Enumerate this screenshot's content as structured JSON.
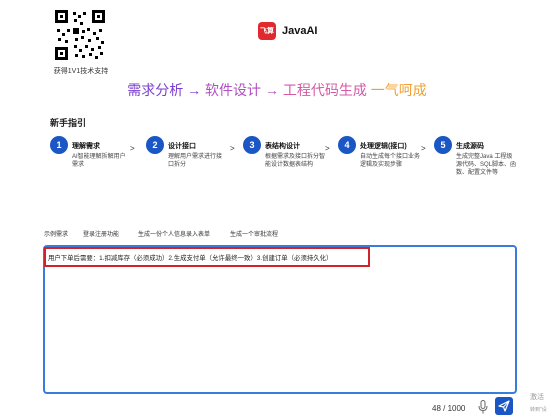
{
  "qr": {
    "caption": "获得1V1技术支持"
  },
  "brand": {
    "logo_text": "飞算",
    "name": "JavaAI"
  },
  "slogan": {
    "part1": "需求分析 → ",
    "part2": "软件设计 → ",
    "part3": "工程代码生成 ",
    "part4": "一气呵成"
  },
  "guide": {
    "title": "新手指引",
    "arrow": ">",
    "steps": [
      {
        "num": "1",
        "title": "理解需求",
        "desc": "AI智能理解拆解用户需求"
      },
      {
        "num": "2",
        "title": "设计接口",
        "desc": "理解用户需求进行接口拆分"
      },
      {
        "num": "3",
        "title": "表结构设计",
        "desc": "根据需求及接口拆分智能设计数据表结构"
      },
      {
        "num": "4",
        "title": "处理逻辑(接口)",
        "desc": "自动生成每个接口业务逻辑及实现步骤"
      },
      {
        "num": "5",
        "title": "生成源码",
        "desc": "生成完整Java 工程级源代码、SQL脚本、函数、配置文件等"
      }
    ]
  },
  "examples": {
    "label": "示例需求",
    "items": [
      "登录注册功能",
      "生成一份个人信息录入表单",
      "生成一个审批流程"
    ]
  },
  "editor": {
    "value": "用户下单后需要：1.扣减库存（必须成功）2.生成支付单（允许最终一致）3.创建订单（必须持久化）",
    "counter": "48 / 1000"
  },
  "watermark": {
    "line1": "激活",
    "line2": "转到\"设"
  },
  "colors": {
    "primary": "#1a56c4",
    "highlight_border": "#d0242a",
    "editor_border": "#3a7be0",
    "brand_red": "#e0282e"
  },
  "icons": {
    "send": "send-icon",
    "mic": "microphone-icon"
  }
}
